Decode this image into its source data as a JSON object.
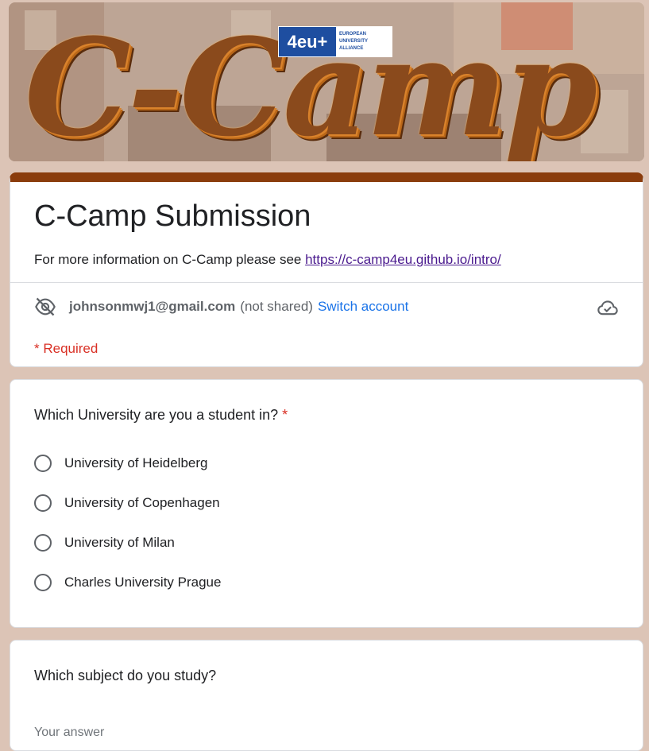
{
  "banner": {
    "title": "C-Camp",
    "logo_mark": "4eu+",
    "logo_text": [
      "EUROPEAN",
      "UNIVERSITY",
      "ALLIANCE"
    ]
  },
  "header": {
    "title": "C-Camp Submission",
    "description_prefix": "For more information on C-Camp please see ",
    "description_link": "https://c-camp4eu.github.io/intro/",
    "account_email": "johnsonmwj1@gmail.com",
    "account_status": "(not shared)",
    "switch_account": "Switch account",
    "required_note": "* Required",
    "icons": {
      "visibility": "eye-off-icon",
      "cloud": "cloud-check-icon"
    },
    "accent_color": "#8a3c0c"
  },
  "question1": {
    "title": "Which University are you a student in?",
    "required_mark": "*",
    "options": [
      "University of Heidelberg",
      "University of Copenhagen",
      "University of Milan",
      "Charles University Prague"
    ]
  },
  "question2": {
    "title": "Which subject do you study?",
    "placeholder": "Your answer"
  },
  "colors": {
    "background": "#dcc4b6",
    "link": "#4a1a8e",
    "accent_blue": "#1a73e8",
    "required_red": "#d93025"
  }
}
